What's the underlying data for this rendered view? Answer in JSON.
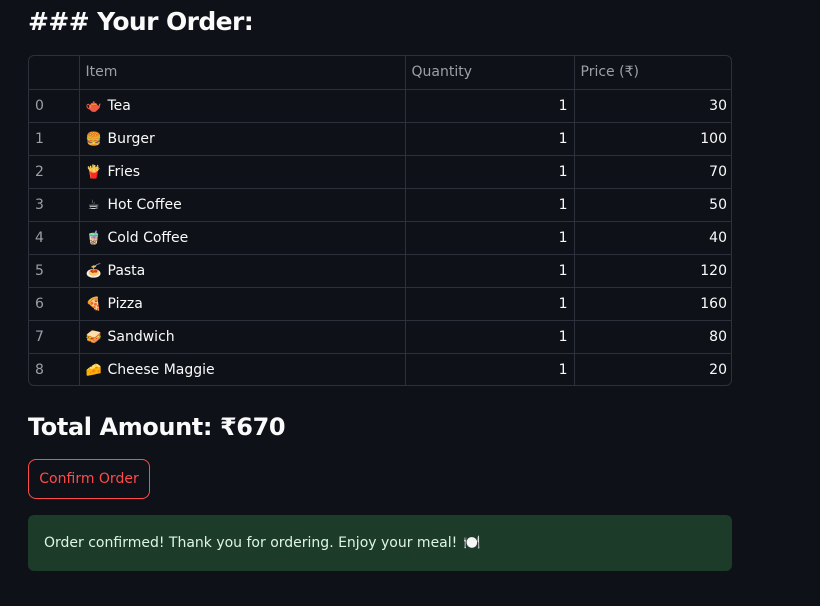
{
  "heading": "### Your Order:",
  "table": {
    "columns": {
      "index": "",
      "item": "Item",
      "quantity": "Quantity",
      "price": "Price (₹)"
    },
    "rows": [
      {
        "index": "0",
        "icon": "🫖",
        "item": "Tea",
        "quantity": "1",
        "price": "30"
      },
      {
        "index": "1",
        "icon": "🍔",
        "item": "Burger",
        "quantity": "1",
        "price": "100"
      },
      {
        "index": "2",
        "icon": "🍟",
        "item": "Fries",
        "quantity": "1",
        "price": "70"
      },
      {
        "index": "3",
        "icon": "☕",
        "item": "Hot Coffee",
        "quantity": "1",
        "price": "50"
      },
      {
        "index": "4",
        "icon": "🧋",
        "item": "Cold Coffee",
        "quantity": "1",
        "price": "40"
      },
      {
        "index": "5",
        "icon": "🍝",
        "item": "Pasta",
        "quantity": "1",
        "price": "120"
      },
      {
        "index": "6",
        "icon": "🍕",
        "item": "Pizza",
        "quantity": "1",
        "price": "160"
      },
      {
        "index": "7",
        "icon": "🥪",
        "item": "Sandwich",
        "quantity": "1",
        "price": "80"
      },
      {
        "index": "8",
        "icon": "🧀",
        "item": "Cheese Maggie",
        "quantity": "1",
        "price": "20"
      }
    ]
  },
  "total": "Total Amount: ₹670",
  "confirm_button": "Confirm Order",
  "success": {
    "message": "Order confirmed! Thank you for ordering. Enjoy your meal!",
    "icon": "🍽️"
  },
  "colors": {
    "background": "#0e1117",
    "accent": "#ff4b4b",
    "success_bg": "#1c3b29"
  }
}
